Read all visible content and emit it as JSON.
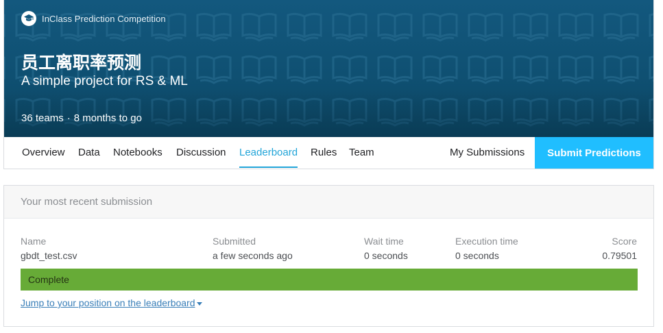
{
  "banner": {
    "competition_type": "InClass Prediction Competition",
    "type_icon": "graduation-cap-icon",
    "title": "员工离职率预测",
    "subtitle": "A simple project for RS & ML",
    "teams": "36 teams",
    "separator": "·",
    "time_left": "8 months to go",
    "pattern_icon": "book-icon"
  },
  "nav": {
    "tabs": [
      {
        "label": "Overview",
        "active": false
      },
      {
        "label": "Data",
        "active": false
      },
      {
        "label": "Notebooks",
        "active": false
      },
      {
        "label": "Discussion",
        "active": false
      },
      {
        "label": "Leaderboard",
        "active": true
      },
      {
        "label": "Rules",
        "active": false
      },
      {
        "label": "Team",
        "active": false
      }
    ],
    "my_submissions": "My Submissions",
    "submit_label": "Submit Predictions"
  },
  "submission": {
    "header": "Your most recent submission",
    "columns": {
      "name_label": "Name",
      "submitted_label": "Submitted",
      "wait_label": "Wait time",
      "exec_label": "Execution time",
      "score_label": "Score"
    },
    "row": {
      "name": "gbdt_test.csv",
      "submitted": "a few seconds ago",
      "wait": "0 seconds",
      "exec": "0 seconds",
      "score": "0.79501"
    },
    "status": "Complete",
    "jump_link": "Jump to your position on the leaderboard",
    "caret_icon": "caret-down-icon"
  },
  "colors": {
    "banner": "#13587e",
    "accent": "#20a4d8",
    "submit": "#20beff",
    "complete": "#67ab37",
    "link": "#3a7fb8"
  }
}
